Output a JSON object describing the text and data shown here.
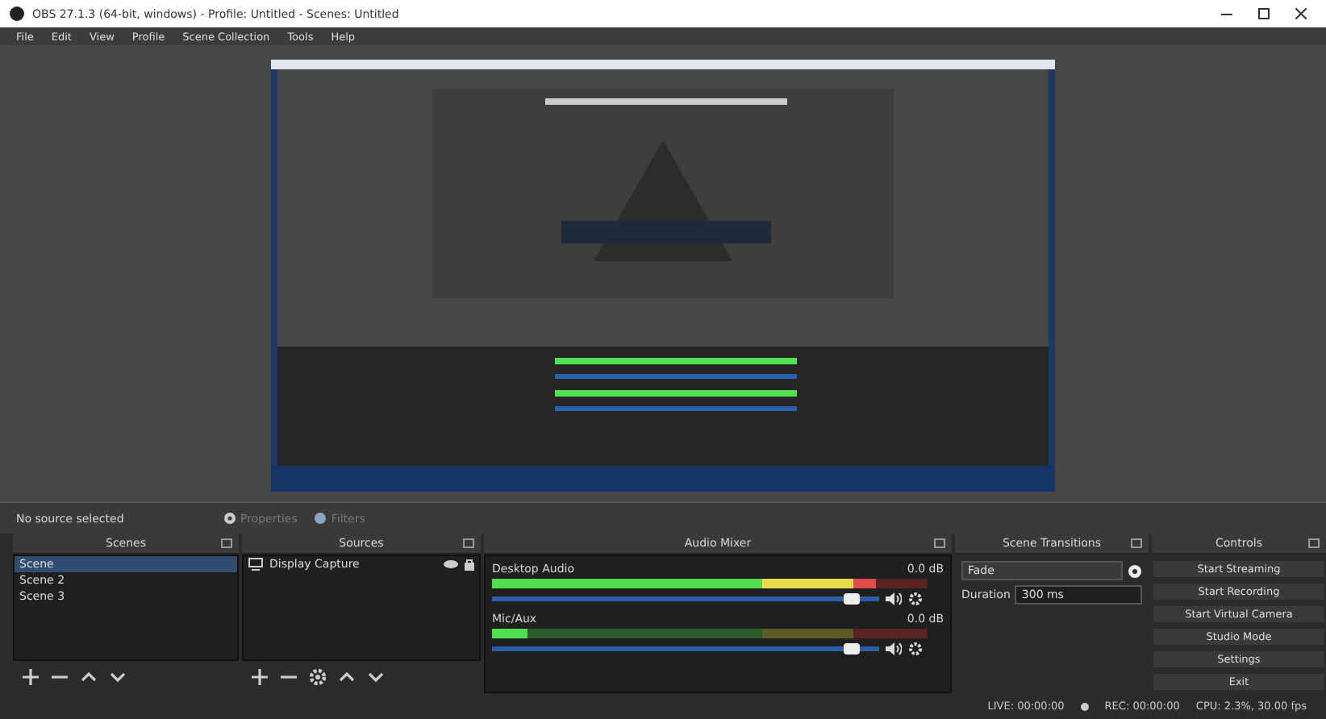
{
  "window": {
    "title": "OBS 27.1.3 (64-bit, windows) - Profile: Untitled - Scenes: Untitled"
  },
  "menu": [
    "File",
    "Edit",
    "View",
    "Profile",
    "Scene Collection",
    "Tools",
    "Help"
  ],
  "context_bar": {
    "label": "No source selected",
    "buttons": [
      {
        "label": "Properties",
        "disabled": true
      },
      {
        "label": "Filters",
        "disabled": true
      }
    ]
  },
  "scenes": {
    "title": "Scenes",
    "items": [
      {
        "label": "Scene",
        "selected": true
      },
      {
        "label": "Scene 2",
        "selected": false
      },
      {
        "label": "Scene 3",
        "selected": false
      }
    ]
  },
  "sources": {
    "title": "Sources",
    "items": [
      {
        "label": "Display Capture",
        "selected": false
      }
    ]
  },
  "audio_mixer": {
    "title": "Audio Mixer",
    "channels": [
      {
        "name": "Desktop Audio",
        "reading": "0.0 dB",
        "meter": {
          "level": 0.88
        },
        "volume": {
          "level": 0.93
        }
      },
      {
        "name": "Mic/Aux",
        "reading": "0.0 dB",
        "meter": {
          "level": 0.08
        },
        "volume": {
          "level": 0.93
        }
      }
    ]
  },
  "transitions": {
    "title": "Scene Transitions",
    "transition": "Fade",
    "duration_label": "Duration",
    "duration": "300 ms"
  },
  "controls": {
    "title": "Controls",
    "buttons": [
      "Start Streaming",
      "Start Recording",
      "Start Virtual Camera",
      "Studio Mode",
      "Settings",
      "Exit"
    ]
  },
  "status_bar": {
    "live": "LIVE: 00:00:00",
    "rec": "REC: 00:00:00",
    "cpu": "CPU: 2.3%, 30.00 fps"
  }
}
